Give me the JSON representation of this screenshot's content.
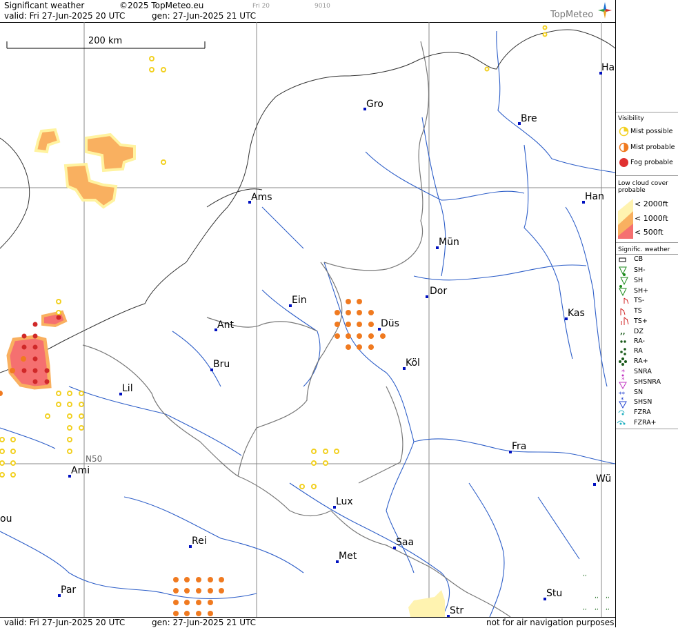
{
  "header": {
    "title": "Significant weather",
    "copyright": "©2025 TopMeteo.eu",
    "small_day": "Fri 20",
    "small_code": "9010",
    "valid": "valid:  Fri  27-Jun-2025  20 UTC",
    "gen": "gen: 27-Jun-2025  21  UTC",
    "brand": "TopMeteo"
  },
  "footer": {
    "valid": "valid:  Fri  27-Jun-2025  20 UTC",
    "gen": "gen: 27-Jun-2025  21  UTC",
    "note": "not for air navigation purposes"
  },
  "map": {
    "scale_label": "200 km",
    "grid_label": "N50",
    "cities": [
      {
        "name": "Gro"
      },
      {
        "name": "Bre"
      },
      {
        "name": "Ha"
      },
      {
        "name": "Ams"
      },
      {
        "name": "Han"
      },
      {
        "name": "Mün"
      },
      {
        "name": "Dor"
      },
      {
        "name": "Ein"
      },
      {
        "name": "Düs"
      },
      {
        "name": "Ant"
      },
      {
        "name": "Kas"
      },
      {
        "name": "Bru"
      },
      {
        "name": "Köl"
      },
      {
        "name": "Lil"
      },
      {
        "name": "Fra"
      },
      {
        "name": "Ami"
      },
      {
        "name": "Wü"
      },
      {
        "name": "Lux"
      },
      {
        "name": "ou"
      },
      {
        "name": "Rei"
      },
      {
        "name": "Saa"
      },
      {
        "name": "Met"
      },
      {
        "name": "Par"
      },
      {
        "name": "Stu"
      },
      {
        "name": "Str"
      }
    ]
  },
  "legend": {
    "visibility_title": "Visibility",
    "visibility": [
      {
        "label": "Mist possible",
        "color": "#f5e050"
      },
      {
        "label": "Mist probable",
        "color": "#f07a20"
      },
      {
        "label": "Fog probable",
        "color": "#e03030"
      }
    ],
    "lowcloud_title_1": "Low cloud cover",
    "lowcloud_title_2": "probable",
    "lowcloud": [
      {
        "label": "< 2000ft",
        "color": "#fff3b0"
      },
      {
        "label": "< 1000ft",
        "color": "#f9b060"
      },
      {
        "label": "<   500ft",
        "color": "#f57070"
      }
    ],
    "sigwx_title": "Signific. weather",
    "sigwx": [
      "CB",
      "SH-",
      "SH",
      "SH+",
      "TS-",
      "TS",
      "TS+",
      "DZ",
      "RA-",
      "RA",
      "RA+",
      "SNRA",
      "SHSNRA",
      "SN",
      "SHSN",
      "FZRA",
      "FZRA+"
    ]
  }
}
